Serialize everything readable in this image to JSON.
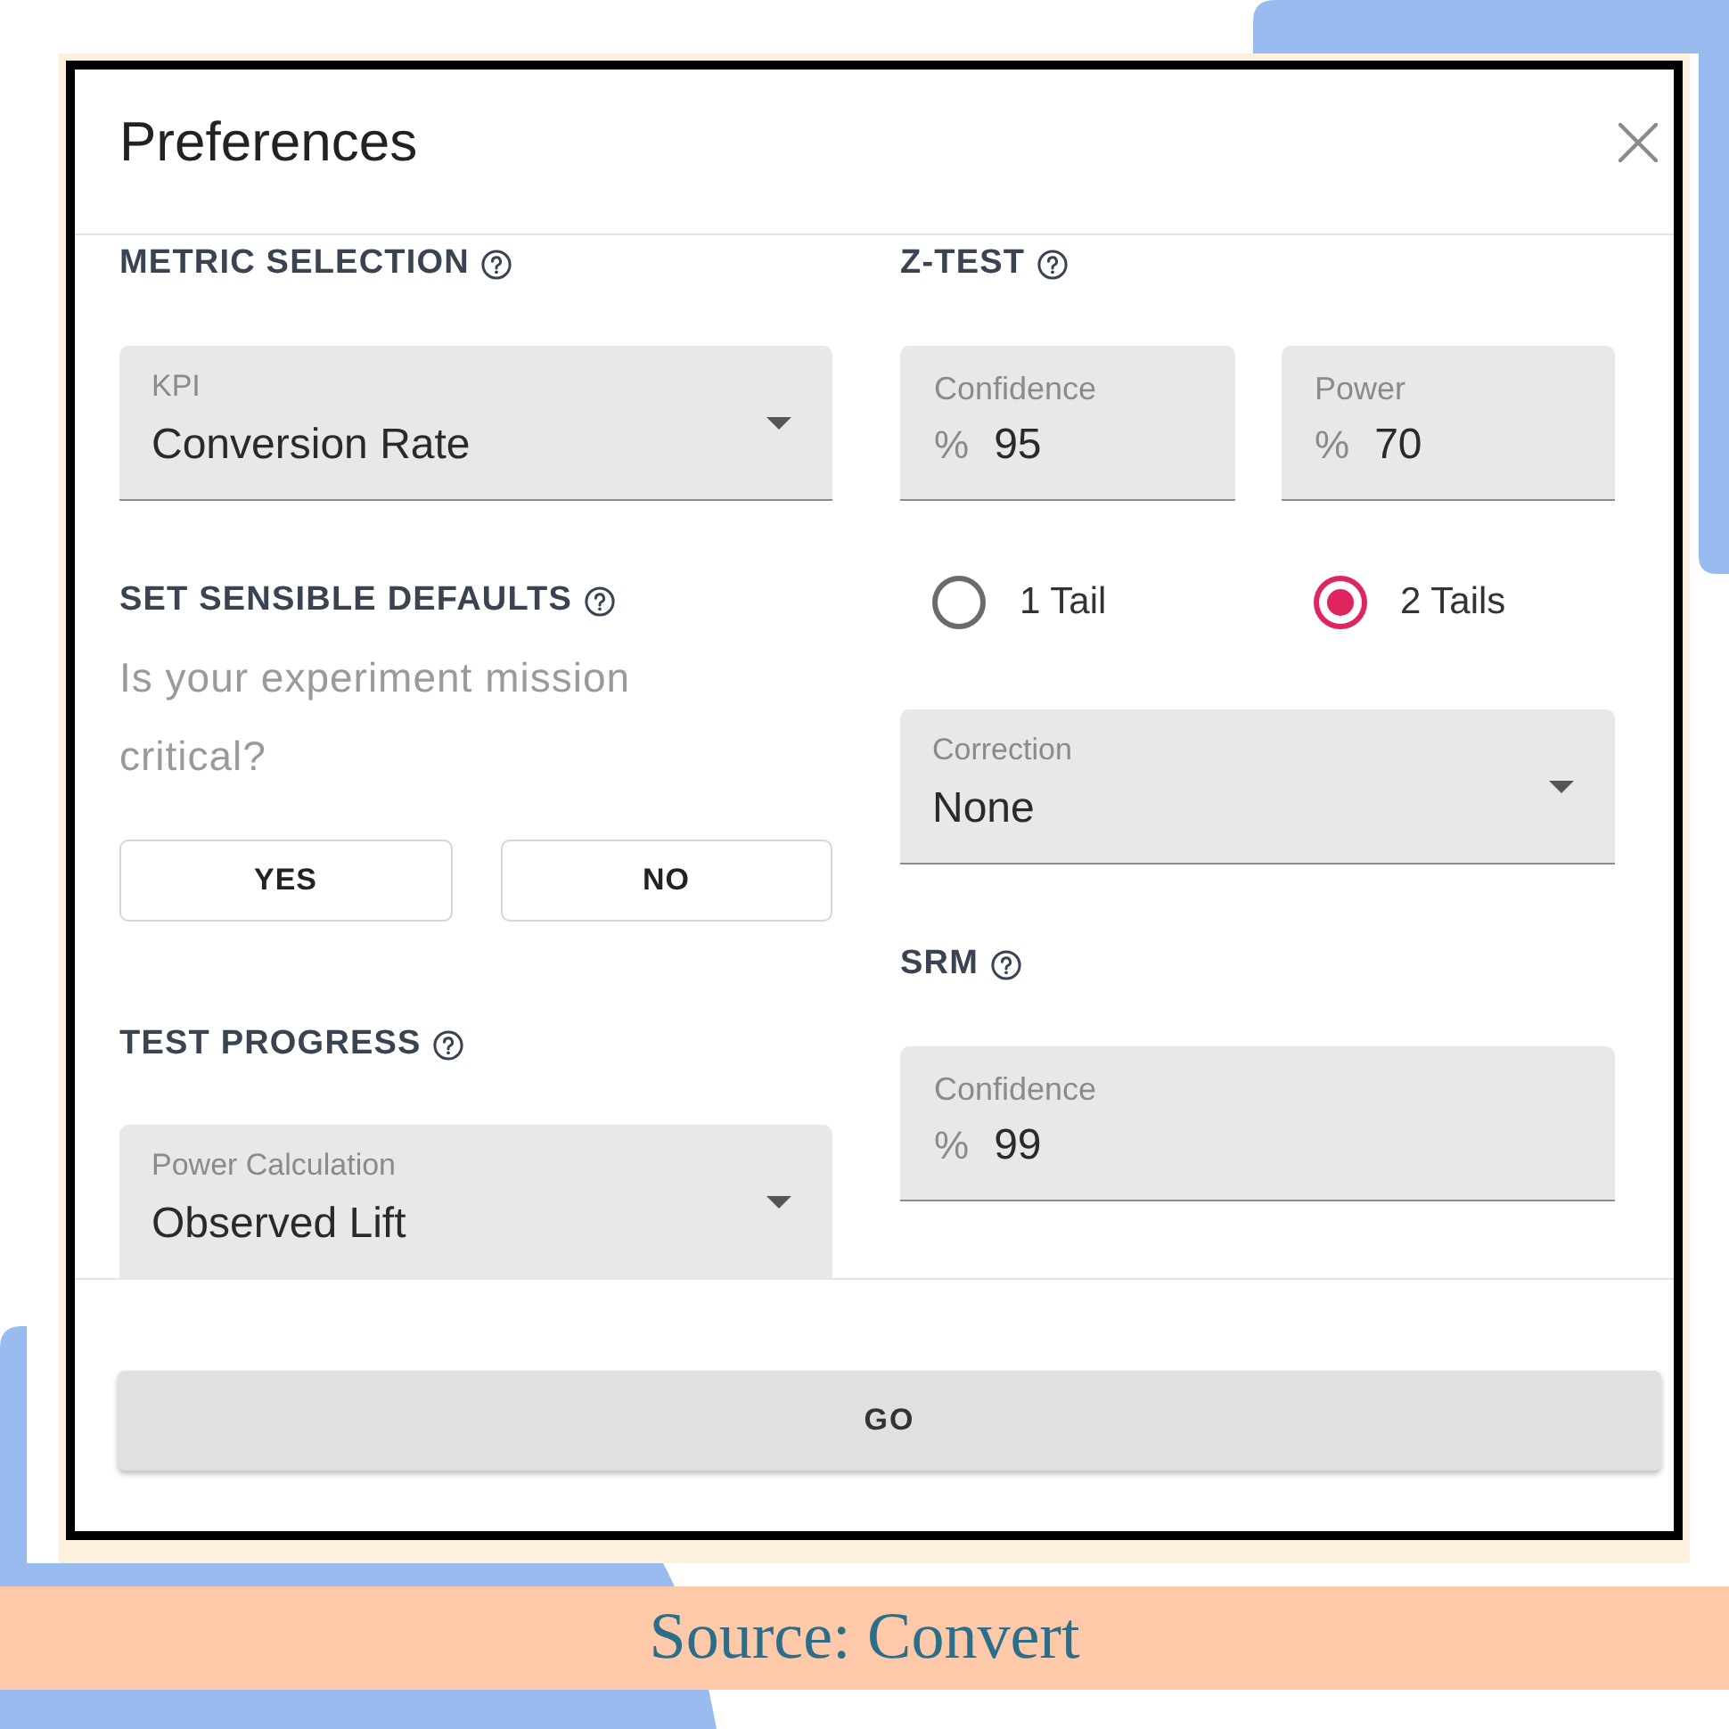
{
  "dialog": {
    "title": "Preferences"
  },
  "metric_selection": {
    "heading": "METRIC SELECTION",
    "select": {
      "label": "KPI",
      "value": "Conversion Rate"
    }
  },
  "sensible_defaults": {
    "heading": "SET SENSIBLE DEFAULTS",
    "question": "Is your experiment mission critical?",
    "buttons": [
      {
        "label": "YES"
      },
      {
        "label": "NO"
      }
    ]
  },
  "test_progress": {
    "heading": "TEST PROGRESS",
    "select": {
      "label": "Power Calculation",
      "value": "Observed Lift"
    }
  },
  "z_test": {
    "heading": "Z-TEST",
    "fields": [
      {
        "label": "Confidence",
        "prefix": "%",
        "value": "95"
      },
      {
        "label": "Power",
        "prefix": "%",
        "value": "70"
      }
    ],
    "tails": [
      {
        "label": "1 Tail",
        "selected": false
      },
      {
        "label": "2 Tails",
        "selected": true
      }
    ],
    "correction": {
      "label": "Correction",
      "value": "None"
    }
  },
  "srm": {
    "heading": "SRM",
    "field": {
      "label": "Confidence",
      "prefix": "%",
      "value": "99"
    }
  },
  "footer": {
    "button": "GO"
  },
  "caption": "Source: Convert"
}
